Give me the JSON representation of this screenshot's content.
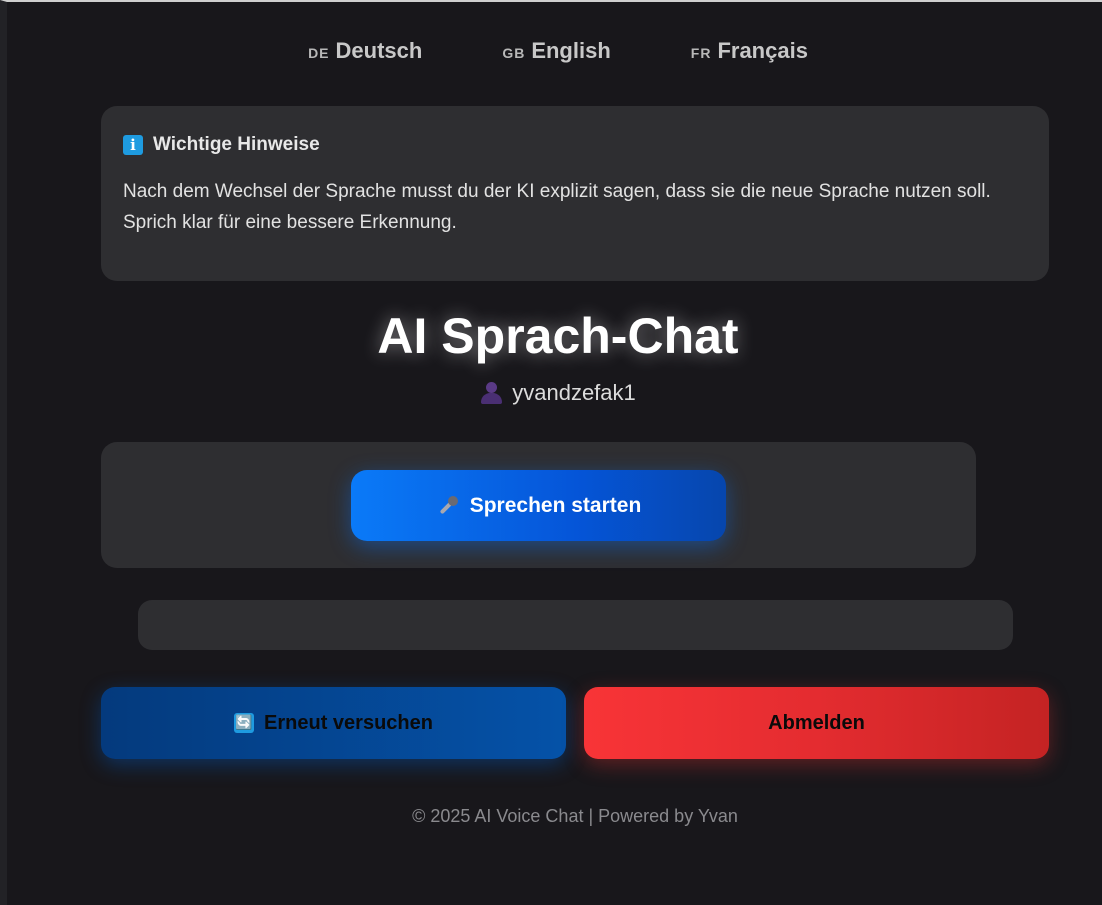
{
  "languages": [
    {
      "code": "DE",
      "name": "Deutsch"
    },
    {
      "code": "GB",
      "name": "English"
    },
    {
      "code": "FR",
      "name": "Français"
    }
  ],
  "notice": {
    "icon": "info-icon",
    "icon_glyph": "i",
    "title": "Wichtige Hinweise",
    "text": "Nach dem Wechsel der Sprache musst du der KI explizit sagen, dass sie die neue Sprache nutzen soll. Sprich klar für eine bessere Erkennung."
  },
  "app": {
    "title": "AI Sprach-Chat",
    "username": "yvandzefak1",
    "user_icon": "user-silhouette-icon"
  },
  "speak": {
    "icon": "microphone-icon",
    "label": "Sprechen starten"
  },
  "transcript": {
    "text": ""
  },
  "actions": {
    "retry_icon": "refresh-icon",
    "retry_icon_glyph": "🔄",
    "retry_label": "Erneut versuchen",
    "logout_label": "Abmelden"
  },
  "footer": {
    "text": "© 2025 AI Voice Chat | Powered by Yvan"
  },
  "colors": {
    "background": "#18171b",
    "card": "#2e2e31",
    "primary_blue": "#0a7af8",
    "dark_blue": "#0552a8",
    "danger_red": "#e42c30"
  }
}
